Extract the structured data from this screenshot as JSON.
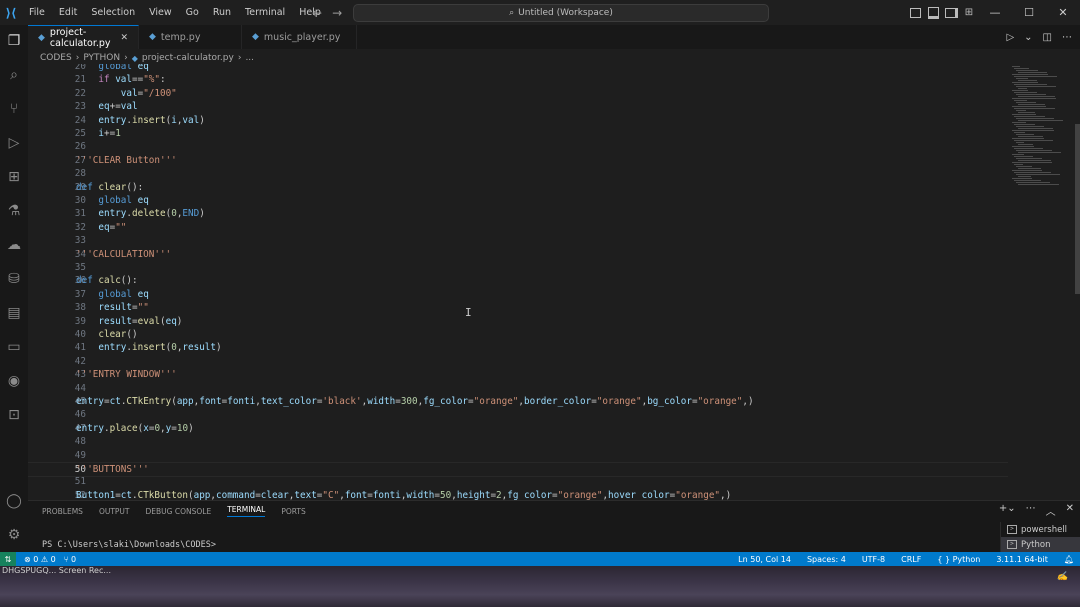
{
  "menu": [
    "File",
    "Edit",
    "Selection",
    "View",
    "Go",
    "Run",
    "Terminal",
    "Help"
  ],
  "command_center": {
    "label": "Untitled (Workspace)"
  },
  "tabs": [
    {
      "label": "project-calculator.py",
      "active": true
    },
    {
      "label": "temp.py",
      "active": false
    },
    {
      "label": "music_player.py",
      "active": false
    }
  ],
  "breadcrumb": {
    "parts": [
      "CODES",
      "PYTHON",
      "project-calculator.py",
      "..."
    ]
  },
  "editor": {
    "lines": [
      {
        "n": "20",
        "text": "    global eq"
      },
      {
        "n": "21",
        "text": "    if val==\"%\":"
      },
      {
        "n": "22",
        "text": "        val=\"/100\""
      },
      {
        "n": "23",
        "text": "    eq+=val"
      },
      {
        "n": "24",
        "text": "    entry.insert(i,val)"
      },
      {
        "n": "25",
        "text": "    i+=1"
      },
      {
        "n": "26",
        "text": ""
      },
      {
        "n": "27",
        "text": "'''CLEAR Button'''"
      },
      {
        "n": "28",
        "text": ""
      },
      {
        "n": "29",
        "text": "def clear():"
      },
      {
        "n": "30",
        "text": "    global eq"
      },
      {
        "n": "31",
        "text": "    entry.delete(0,END)"
      },
      {
        "n": "32",
        "text": "    eq=\"\""
      },
      {
        "n": "33",
        "text": ""
      },
      {
        "n": "34",
        "text": "'''CALCULATION'''"
      },
      {
        "n": "35",
        "text": ""
      },
      {
        "n": "36",
        "text": "def calc():"
      },
      {
        "n": "37",
        "text": "    global eq"
      },
      {
        "n": "38",
        "text": "    result=\"\""
      },
      {
        "n": "39",
        "text": "    result=eval(eq)"
      },
      {
        "n": "40",
        "text": "    clear()"
      },
      {
        "n": "41",
        "text": "    entry.insert(0,result)"
      },
      {
        "n": "42",
        "text": ""
      },
      {
        "n": "43",
        "text": "'''ENTRY WINDOW'''"
      },
      {
        "n": "44",
        "text": ""
      },
      {
        "n": "45",
        "text": "entry=ct.CTkEntry(app,font=fonti,text_color='black',width=300,fg_color=\"orange\",border_color=\"orange\",bg_color=\"orange\",)"
      },
      {
        "n": "46",
        "text": ""
      },
      {
        "n": "47",
        "text": "entry.place(x=0,y=10)"
      },
      {
        "n": "48",
        "text": ""
      },
      {
        "n": "49",
        "text": ""
      },
      {
        "n": "50",
        "text": "'''BUTTONS'''"
      },
      {
        "n": "51",
        "text": ""
      },
      {
        "n": "52",
        "text": "Button1=ct.CTkButton(app,command=clear,text=\"C\",font=fonti,width=50,height=2,fg_color=\"orange\",hover_color=\"orange\",)"
      }
    ]
  },
  "panel": {
    "tabs": [
      "PROBLEMS",
      "OUTPUT",
      "DEBUG CONSOLE",
      "TERMINAL",
      "PORTS"
    ],
    "active_tab": "TERMINAL",
    "terminal_line": "PS C:\\Users\\slaki\\Downloads\\CODES>",
    "terminals": [
      "powershell",
      "Python"
    ]
  },
  "status": {
    "errors": "0",
    "warnings": "0",
    "ports": "0",
    "position": "Ln 50, Col 14",
    "spaces": "Spaces: 4",
    "encoding": "UTF-8",
    "eol": "CRLF",
    "language": "Python",
    "interpreter": "3.11.1 64-bit"
  },
  "taskbar": {
    "text": "DHGSPUGQ... Screen Rec..."
  },
  "colors": {
    "accent": "#007acc",
    "editor_bg": "#1e1e1e",
    "keyword": "#569cd6",
    "string": "#ce9178",
    "function": "#dcdcaa"
  }
}
